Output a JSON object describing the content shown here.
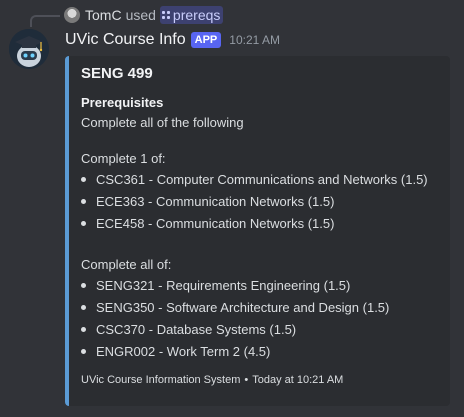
{
  "reply": {
    "user": "TomC",
    "used_text": "used",
    "command": "prereqs"
  },
  "message": {
    "bot_name": "UVic Course Info",
    "app_badge": "APP",
    "timestamp": "10:21 AM"
  },
  "embed": {
    "accent_color": "#5b9bd5",
    "title": "SENG 499",
    "section_heading": "Prerequisites",
    "intro": "Complete all of the following",
    "groups": [
      {
        "label": "Complete 1 of:",
        "items": [
          "CSC361 - Computer Communications and Networks (1.5)",
          "ECE363 - Communication Networks (1.5)",
          "ECE458 - Communication Networks (1.5)"
        ]
      },
      {
        "label": "Complete all of:",
        "items": [
          "SENG321 - Requirements Engineering (1.5)",
          "SENG350 - Software Architecture and Design (1.5)",
          "CSC370 - Database Systems (1.5)",
          "ENGR002 - Work Term 2 (4.5)"
        ]
      }
    ],
    "footer": {
      "source": "UVic Course Information System",
      "separator": "•",
      "time": "Today at 10:21 AM"
    }
  }
}
